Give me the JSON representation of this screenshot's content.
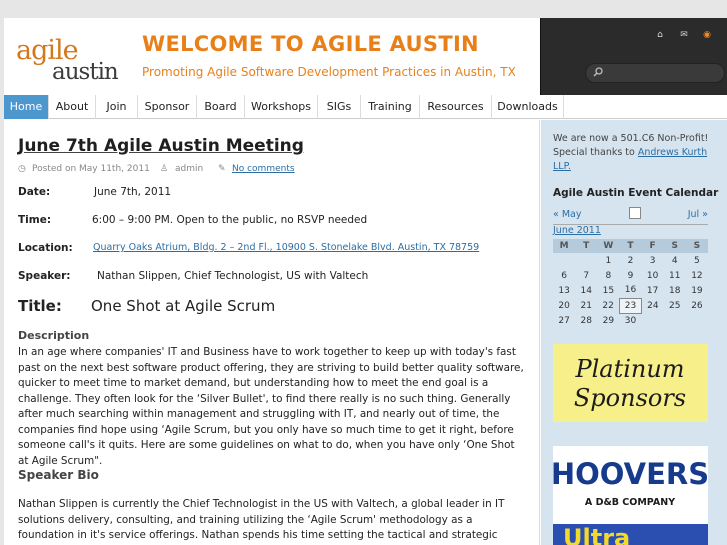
{
  "header": {
    "logo_top": "agile",
    "logo_bottom": "austin",
    "title": "WELCOME TO AGILE AUSTIN",
    "tagline": "Promoting Agile Software Development Practices in Austin, TX",
    "icons": [
      "home-icon",
      "mail-icon",
      "rss-icon"
    ],
    "search_placeholder": ""
  },
  "nav": {
    "items": [
      "Home",
      "About",
      "Join",
      "Sponsor",
      "Board",
      "Workshops",
      "SIGs",
      "Training",
      "Resources",
      "Downloads"
    ],
    "active": "Home"
  },
  "post": {
    "title": "June 7th Agile Austin Meeting",
    "meta_posted": "Posted on May 11th, 2011",
    "meta_author": "admin",
    "meta_comments": "No comments",
    "date_label": "Date:",
    "date_value": "June 7th, 2011",
    "time_label": "Time:",
    "time_value": "6:00 – 9:00 PM.  Open to the public, no RSVP needed",
    "location_label": "Location:",
    "location_value": "Quarry Oaks Atrium, Bldg. 2 – 2nd Fl., 10900 S. Stonelake Blvd. Austin, TX  78759",
    "speaker_label": "Speaker:",
    "speaker_value": "Nathan Slippen, Chief Technologist, US with Valtech",
    "title_label": "Title:",
    "title_value": "One Shot at Agile Scrum",
    "description_heading": "Description",
    "description": "In an age where companies' IT and Business have to work together to keep up with today's fast past on the next best software product offering, they are striving to build better quality software, quicker to meet time to market demand, but understanding how to meet the end goal is a challenge. They often look for the ‘Silver Bullet', to find there really is no such thing. Generally after much searching within management and struggling with IT, and nearly out of time, the companies find hope using ‘Agile Scrum, but you only have so much time to get it right, before someone call's it quits. Here are some guidelines on what to do, when you have only ‘One Shot at Agile Scrum\".",
    "bio_heading": "Speaker Bio",
    "bio": "Nathan Slippen is currently the Chief Technologist in the US with Valtech, a global leader in IT solutions delivery, consulting, and training utilizing the ‘Agile Scrum' methodology as a foundation in it's service offerings. Nathan spends his time setting the tactical and strategic direction in the US, as well as with our"
  },
  "sidebar": {
    "npo_text": "We are now a 501.C6 Non-Profit! Special thanks to ",
    "npo_link": "Andrews Kurth LLP.",
    "calendar_heading": "Agile Austin Event Calendar",
    "prev": "« May",
    "next": "Jul »",
    "month": "June 2011",
    "weekdays": [
      "M",
      "T",
      "W",
      "T",
      "F",
      "S",
      "S"
    ],
    "weeks": [
      [
        "",
        "",
        "1",
        "2",
        "3",
        "4",
        "5"
      ],
      [
        "6",
        "7",
        "8",
        "9",
        "10",
        "11",
        "12"
      ],
      [
        "13",
        "14",
        "15",
        "16",
        "17",
        "18",
        "19"
      ],
      [
        "20",
        "21",
        "22",
        "23",
        "24",
        "25",
        "26"
      ],
      [
        "27",
        "28",
        "29",
        "30",
        "",
        "",
        ""
      ]
    ],
    "today": "23",
    "banner_platinum_line1": "Platinum",
    "banner_platinum_line2": "Sponsors",
    "banner_hoovers": "HOOVERS",
    "banner_hoovers_sub": "A D&B COMPANY",
    "banner_ultra": "Ultra"
  }
}
